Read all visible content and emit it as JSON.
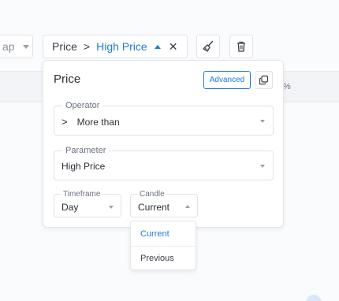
{
  "toolbar": {
    "prev_chip_label": "ap",
    "filter_chip": {
      "name": "Price",
      "operator_symbol": ">",
      "parameter": "High Price"
    },
    "clean_icon": "broom-icon",
    "delete_icon": "trash-icon"
  },
  "background": {
    "percent_label": "%"
  },
  "panel": {
    "title": "Price",
    "advanced_label": "Advanced",
    "operator": {
      "legend": "Operator",
      "symbol": ">",
      "value": "More than"
    },
    "parameter": {
      "legend": "Parameter",
      "value": "High Price"
    },
    "timeframe": {
      "legend": "Timeframe",
      "value": "Day"
    },
    "candle": {
      "legend": "Candle",
      "value": "Current",
      "options": [
        "Current",
        "Previous"
      ]
    }
  },
  "colors": {
    "accent": "#1f7ae0",
    "border": "#dfe3e8",
    "text": "#2b2f36"
  }
}
